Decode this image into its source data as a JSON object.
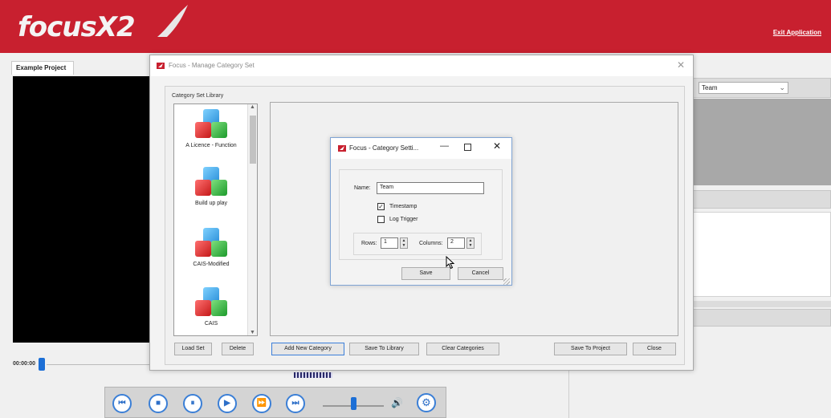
{
  "app": {
    "logo_text": "focusX2",
    "exit_label": "Exit Application",
    "project_tab": "Example Project",
    "timecode": "00:00:00",
    "team_select": "Team",
    "colors": {
      "brand_red": "#c8202f",
      "accent_blue": "#1c6fd6"
    }
  },
  "playback": {
    "buttons": [
      {
        "icon": "skip-back-icon",
        "glyph": "⏮"
      },
      {
        "icon": "stop-icon",
        "glyph": "■"
      },
      {
        "icon": "pause-icon",
        "glyph": "⏸"
      },
      {
        "icon": "play-icon",
        "glyph": "▶"
      },
      {
        "icon": "fast-forward-icon",
        "glyph": "⏩"
      },
      {
        "icon": "skip-forward-icon",
        "glyph": "⏭"
      }
    ],
    "volume_icon": "🔊",
    "settings_icon": "⚙"
  },
  "manager": {
    "title": "Focus - Manage Category Set",
    "library_label": "Category Set Library",
    "library_items": [
      "A Licence - Function",
      "Build up play",
      "CAIS-Modified",
      "CAIS"
    ],
    "buttons": {
      "load_set": "Load Set",
      "delete": "Delete",
      "add_new_category": "Add New Category",
      "save_to_library": "Save To Library",
      "clear_categories": "Clear Categories",
      "save_to_project": "Save To Project",
      "close": "Close"
    }
  },
  "settings_dialog": {
    "title": "Focus - Category Setti...",
    "name_label": "Name:",
    "name_value": "Team",
    "timestamp_label": "Timestamp",
    "timestamp_checked": true,
    "log_trigger_label": "Log Trigger",
    "log_trigger_checked": false,
    "rows_label": "Rows:",
    "rows_value": "1",
    "columns_label": "Columns:",
    "columns_value": "2",
    "save_label": "Save",
    "cancel_label": "Cancel"
  }
}
